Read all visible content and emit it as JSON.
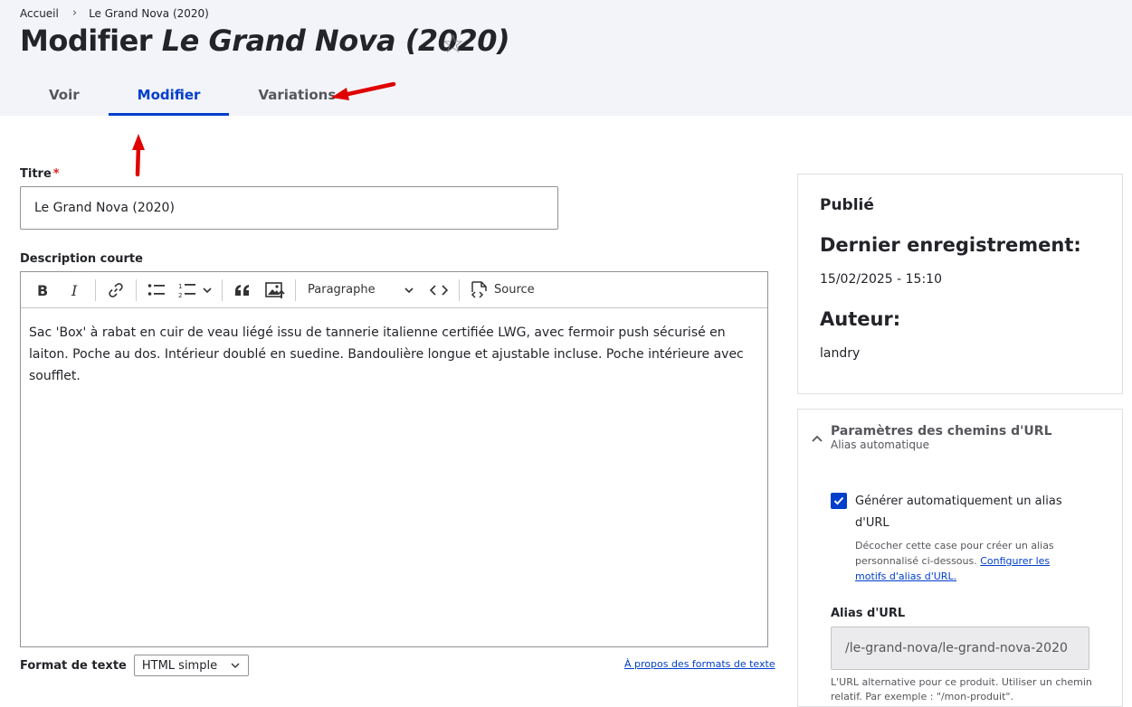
{
  "breadcrumb": {
    "home": "Accueil",
    "separator": "›",
    "current": "Le Grand Nova (2020)"
  },
  "title": {
    "prefix": "Modifier",
    "name": "Le Grand Nova (2020)",
    "star": "☆"
  },
  "tabs": [
    {
      "label": "Voir"
    },
    {
      "label": "Modifier"
    },
    {
      "label": "Variations"
    }
  ],
  "form": {
    "title_label": "Titre",
    "required_mark": "*",
    "title_value": "Le Grand Nova (2020)",
    "description_label": "Description courte",
    "description_text": "Sac 'Box' à rabat en cuir de veau liégé issu de tannerie italienne certifiée LWG, avec fermoir push sécurisé en laiton. Poche au dos. Intérieur doublé en suedine. Bandoulière longue et ajustable incluse. Poche intérieure avec soufflet.",
    "toolbar": {
      "paragraph": "Paragraphe",
      "source": "Source"
    },
    "format_label": "Format de texte",
    "format_value": "HTML simple",
    "format_link": "À propos des formats de texte"
  },
  "sidebar": {
    "status": "Publié",
    "last_saved_label": "Dernier enregistrement:",
    "last_saved_value": "15/02/2025 - 15:10",
    "author_label": "Auteur:",
    "author_value": "landry"
  },
  "url_settings": {
    "title": "Paramètres des chemins d'URL",
    "summary": "Alias automatique",
    "checkbox_label": "Générer automatiquement un alias d'URL",
    "checkbox_checked": true,
    "description": "Décocher cette case pour créer un alias personnalisé ci-dessous.",
    "description_link": "Configurer les motifs d'alias d'URL.",
    "alias_label": "Alias d'URL",
    "alias_value": "/le-grand-nova/le-grand-nova-2020",
    "alias_help": "L'URL alternative pour ce produit. Utiliser un chemin relatif. Par exemple : \"/mon-produit\"."
  },
  "colors": {
    "accent": "#003ecc",
    "header_bg": "#f3f4f9",
    "annotation_arrow": "#e00000"
  }
}
